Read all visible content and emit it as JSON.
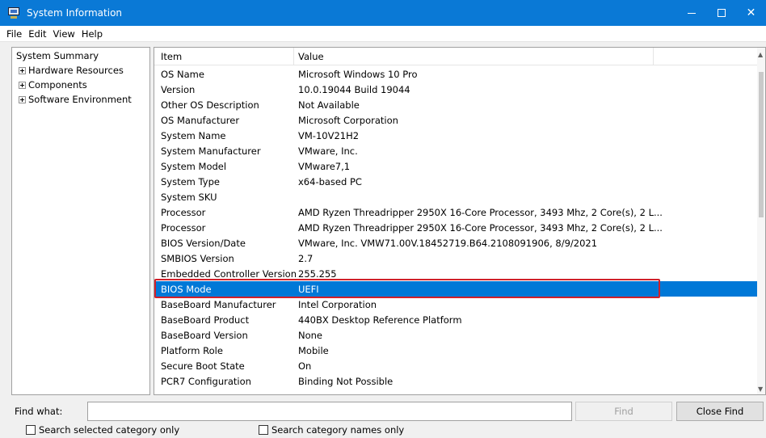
{
  "window": {
    "title": "System Information"
  },
  "menu": [
    "File",
    "Edit",
    "View",
    "Help"
  ],
  "tree": {
    "root": "System Summary",
    "children": [
      "Hardware Resources",
      "Components",
      "Software Environment"
    ]
  },
  "list": {
    "headers": [
      "Item",
      "Value"
    ],
    "rows": [
      {
        "item": "OS Name",
        "value": "Microsoft Windows 10 Pro"
      },
      {
        "item": "Version",
        "value": "10.0.19044 Build 19044"
      },
      {
        "item": "Other OS Description",
        "value": "Not Available"
      },
      {
        "item": "OS Manufacturer",
        "value": "Microsoft Corporation"
      },
      {
        "item": "System Name",
        "value": "VM-10V21H2"
      },
      {
        "item": "System Manufacturer",
        "value": "VMware, Inc."
      },
      {
        "item": "System Model",
        "value": "VMware7,1"
      },
      {
        "item": "System Type",
        "value": "x64-based PC"
      },
      {
        "item": "System SKU",
        "value": ""
      },
      {
        "item": "Processor",
        "value": "AMD Ryzen Threadripper 2950X 16-Core Processor, 3493 Mhz, 2 Core(s), 2 L..."
      },
      {
        "item": "Processor",
        "value": "AMD Ryzen Threadripper 2950X 16-Core Processor, 3493 Mhz, 2 Core(s), 2 L..."
      },
      {
        "item": "BIOS Version/Date",
        "value": "VMware, Inc. VMW71.00V.18452719.B64.2108091906, 8/9/2021"
      },
      {
        "item": "SMBIOS Version",
        "value": "2.7"
      },
      {
        "item": "Embedded Controller Version",
        "value": "255.255"
      },
      {
        "item": "BIOS Mode",
        "value": "UEFI"
      },
      {
        "item": "BaseBoard Manufacturer",
        "value": "Intel Corporation"
      },
      {
        "item": "BaseBoard Product",
        "value": "440BX Desktop Reference Platform"
      },
      {
        "item": "BaseBoard Version",
        "value": "None"
      },
      {
        "item": "Platform Role",
        "value": "Mobile"
      },
      {
        "item": "Secure Boot State",
        "value": "On"
      },
      {
        "item": "PCR7 Configuration",
        "value": "Binding Not Possible"
      }
    ],
    "selected_row": 14,
    "highlight_color": "#d0202a",
    "selection_color": "#0078d7"
  },
  "find": {
    "label": "Find what:",
    "value": "",
    "find_button": "Find",
    "close_button": "Close Find",
    "check_selected": "Search selected category only",
    "check_names": "Search category names only"
  },
  "colors": {
    "titlebar": "#0a79d6"
  }
}
